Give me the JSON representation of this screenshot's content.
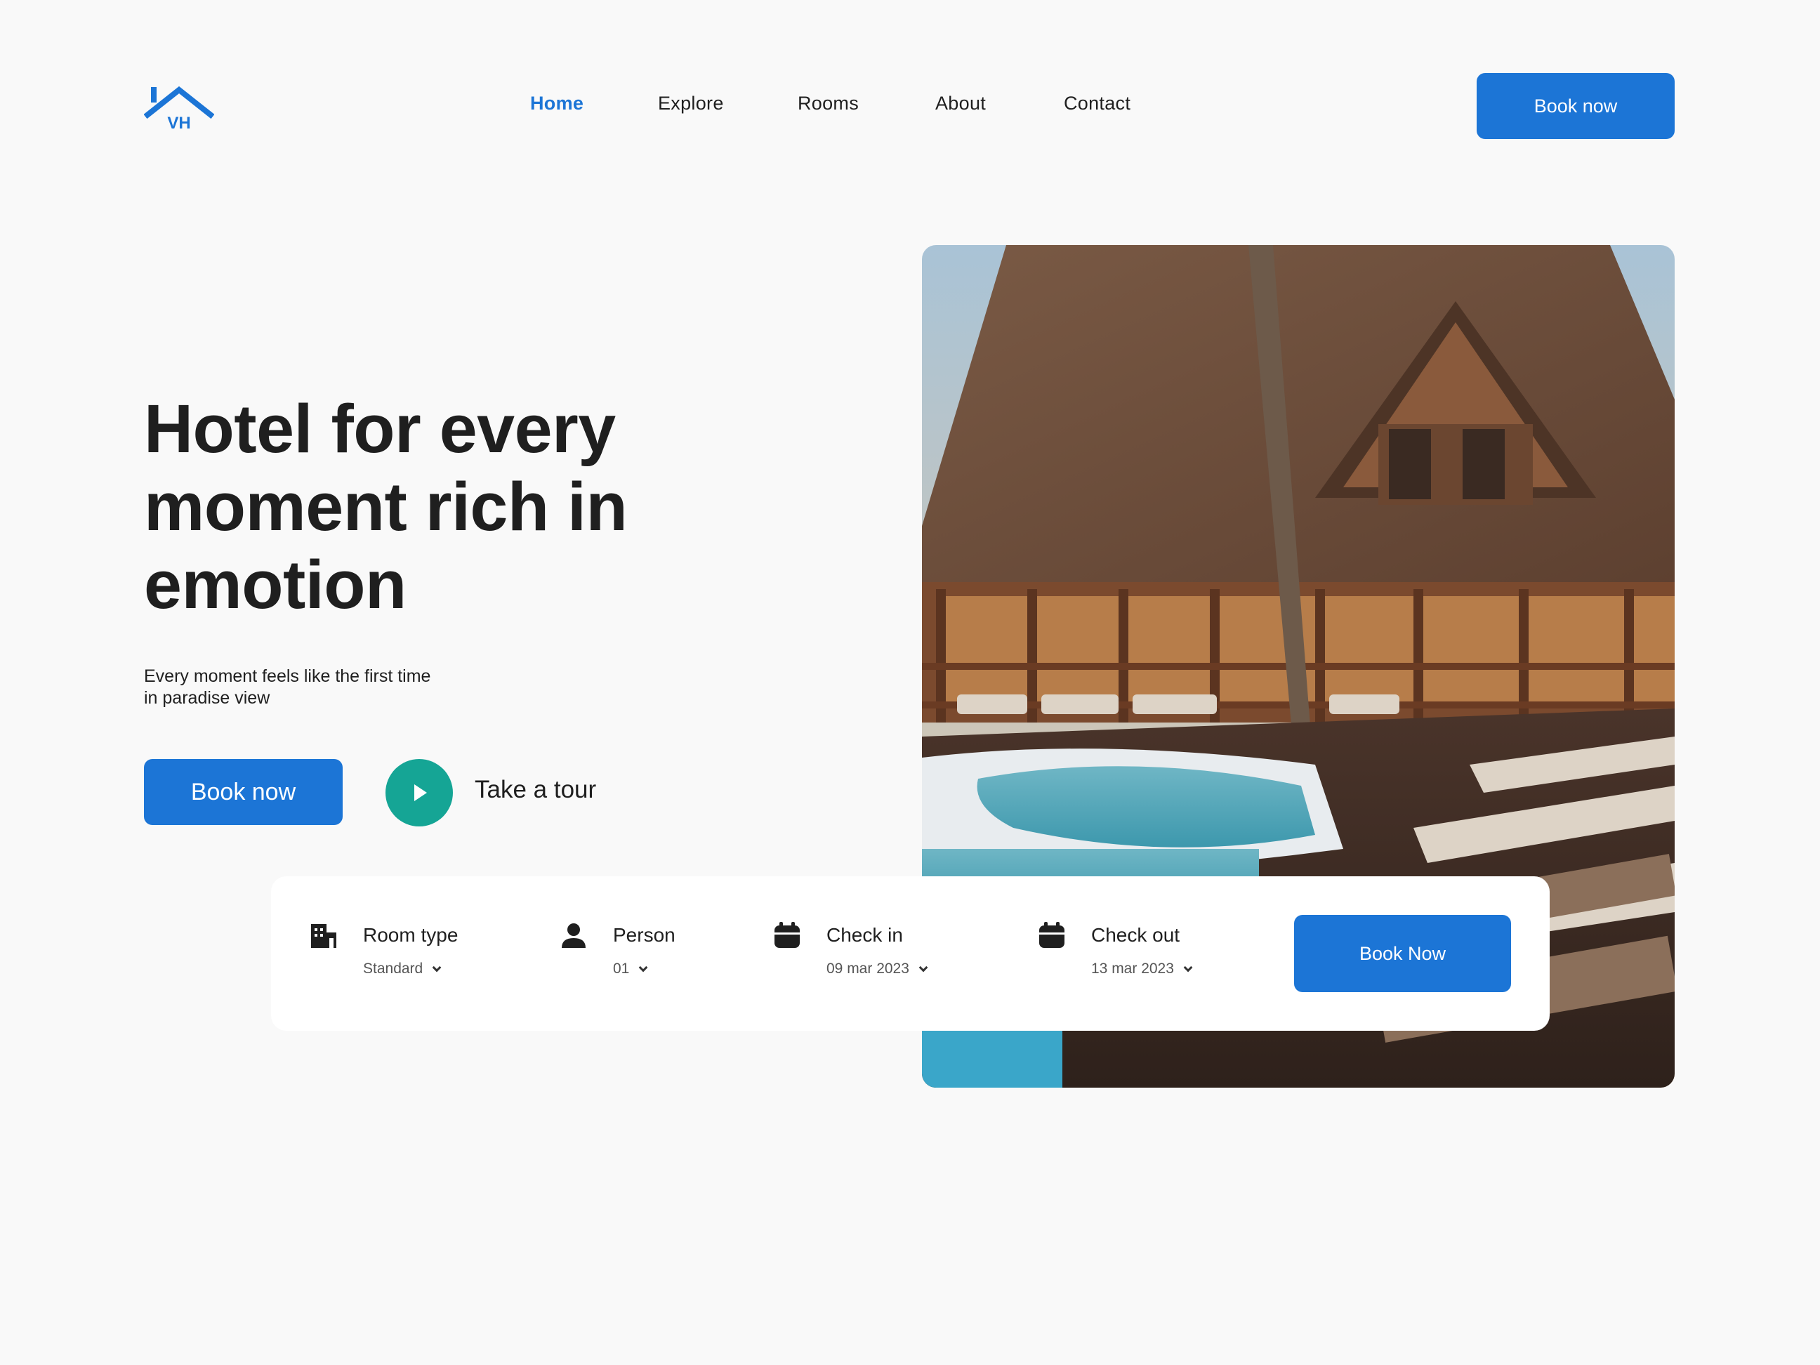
{
  "header": {
    "logo_text": "VH",
    "nav": [
      {
        "label": "Home",
        "active": true
      },
      {
        "label": "Explore",
        "active": false
      },
      {
        "label": "Rooms",
        "active": false
      },
      {
        "label": "About",
        "active": false
      },
      {
        "label": "Contact",
        "active": false
      }
    ],
    "book_label": "Book now"
  },
  "hero": {
    "title": "Hotel for every moment rich in emotion",
    "subtitle_line1": "Every moment feels like the first time",
    "subtitle_line2": "in paradise view",
    "book_label": "Book now",
    "tour_label": "Take a tour"
  },
  "booking": {
    "room_type": {
      "label": "Room type",
      "value": "Standard",
      "icon": "building-icon"
    },
    "person": {
      "label": "Person",
      "value": "01",
      "icon": "person-icon"
    },
    "check_in": {
      "label": "Check in",
      "value": "09 mar 2023",
      "icon": "calendar-icon"
    },
    "check_out": {
      "label": "Check out",
      "value": "13 mar 2023",
      "icon": "calendar-icon"
    },
    "book_label": "Book Now"
  },
  "colors": {
    "accent": "#1c75d6",
    "play": "#15a595",
    "background": "#f9f9f9",
    "text": "#1f1f1f"
  }
}
